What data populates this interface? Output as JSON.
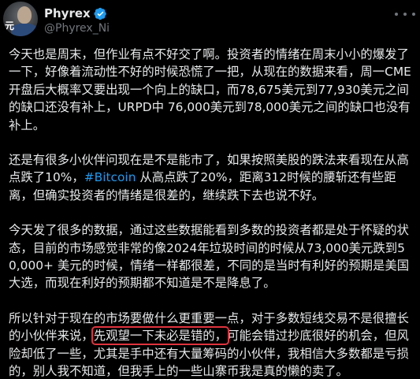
{
  "author": {
    "name": "Phyrex",
    "handle": "@Phyrex_Ni",
    "avatar_text": "元"
  },
  "colors": {
    "background": "#000000",
    "text": "#e7e9ea",
    "secondary": "#71767b",
    "link": "#1d9bf0",
    "verified": "#1d9bf0",
    "highlight_box": "#e0333d"
  },
  "icons": {
    "verified": "verified-badge-icon",
    "more": "more-options-icon"
  },
  "tweet": {
    "p1": "今天也是周末，但作业有点不好交了啊。投资者的情绪在周末小小的爆发了一下，好像着流动性不好的时候恐慌了一把，从现在的数据来看，周一CME开盘后大概率又要出现一个向上的缺口，而78,675美元到77,930美元之间的缺口还没有补上，URPD中 76,000美元到78,000美元之间的缺口也没有补上。",
    "p2_before": "还是有很多小伙伴问现在是不是能市了，如果按照美股的跌法来看现在从高点跌了10%，",
    "p2_hashtag": "#Bitcoin",
    "p2_after": " 从高点跌了20%，距离312时候的腰斩还有些距离，但确实投资者的情绪是很差的，继续跌下去也说不好。",
    "p3": "今天发了很多的数据，通过这些数据能看到多数的投资者都是处于怀疑的状态，目前的市场感觉非常的像2024年垃圾时间的时候从73,000美元跌到50,000+ 美元的时候，情绪一样都很差，不同的是当时有利好的预期是美国大选，而现在利好的预期都不知道是不是降息了。",
    "p4_before": "所以针对于现在的市场要做什么更重要一点，对于多数短线交易不是很擅长的小伙伴来说，",
    "p4_highlight": "先观望一下未必是错的，",
    "p4_after": "可能会错过抄底很好的机会，但风险却低了一些，尤其是手中还有大量筹码的小伙伴，我相信大多数都是亏损的，别人我不知道，但我手上的一些山寨币我是真的懒的卖了。"
  }
}
